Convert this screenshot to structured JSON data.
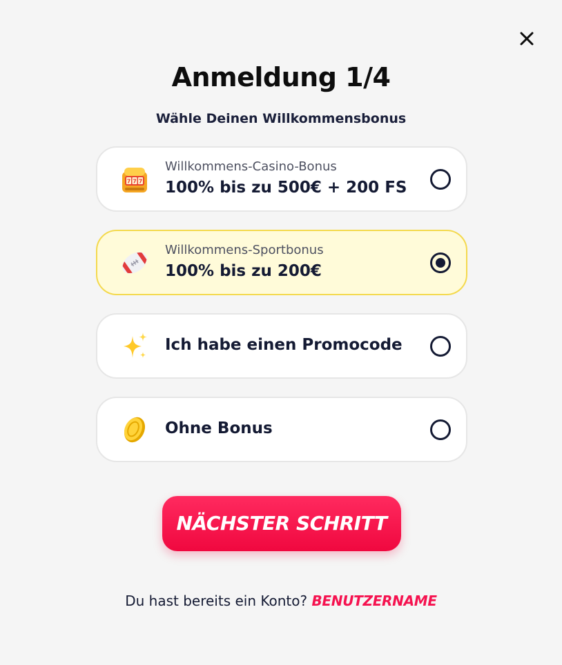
{
  "header": {
    "title": "Anmeldung 1/4",
    "subtitle": "Wähle Deinen Willkommensbonus"
  },
  "options": [
    {
      "small": "Willkommens-Casino-Bonus",
      "big": "100% bis zu 500€ + 200 FS",
      "icon": "slot-machine-icon",
      "selected": false
    },
    {
      "small": "Willkommens-Sportbonus",
      "big": "100% bis zu 200€",
      "icon": "football-icon",
      "selected": true
    },
    {
      "small": "",
      "big": "Ich habe einen Promocode",
      "icon": "sparkles-icon",
      "selected": false
    },
    {
      "small": "",
      "big": "Ohne Bonus",
      "icon": "coin-icon",
      "selected": false
    }
  ],
  "next_button": {
    "label": "NÄCHSTER SCHRITT"
  },
  "login": {
    "prompt": "Du hast bereits ein Konto?",
    "link": "BENUTZERNAME"
  },
  "colors": {
    "accent": "#f5124f",
    "selected_bg": "#fffbd9",
    "selected_border": "#f4d94d",
    "text_dark": "#141a33"
  }
}
